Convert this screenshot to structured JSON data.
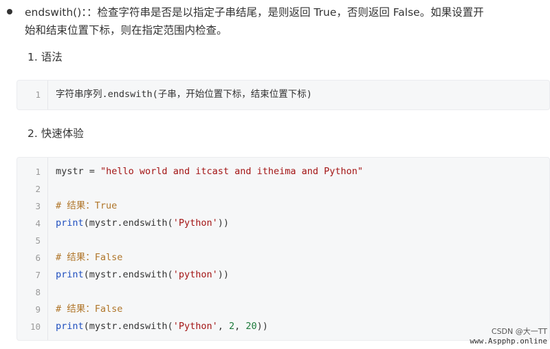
{
  "bullet": {
    "line1": "endswith()：：检查字符串是否是以指定子串结尾，是则返回 True，否则返回 False。如果设置开",
    "line2": "始和结束位置下标，则在指定范围内检查。"
  },
  "sections": [
    {
      "heading": "1. 语法"
    },
    {
      "heading": "2. 快速体验"
    }
  ],
  "syntax_block": {
    "lines": [
      {
        "num": "1",
        "code": "字符串序列.endswith(子串，开始位置下标，结束位置下标)"
      }
    ]
  },
  "demo_block": {
    "lines": [
      {
        "num": "1",
        "parts": {
          "a": "mystr = ",
          "s": "\"hello world and itcast and itheima and Python\""
        }
      },
      {
        "num": "2"
      },
      {
        "num": "3",
        "parts": {
          "c": "# 结果：True"
        }
      },
      {
        "num": "4",
        "parts": {
          "f": "print",
          "a": "(mystr.endswith(",
          "s": "'Python'",
          "b": "))"
        }
      },
      {
        "num": "5"
      },
      {
        "num": "6",
        "parts": {
          "c": "# 结果：False"
        }
      },
      {
        "num": "7",
        "parts": {
          "f": "print",
          "a": "(mystr.endswith(",
          "s": "'python'",
          "b": "))"
        }
      },
      {
        "num": "8"
      },
      {
        "num": "9",
        "parts": {
          "c": "# 结果：False"
        }
      },
      {
        "num": "10",
        "parts": {
          "f": "print",
          "a": "(mystr.endswith(",
          "s": "'Python'",
          "b": ", ",
          "n1": "2",
          "d": ", ",
          "n2": "20",
          "e": "))"
        }
      }
    ]
  },
  "watermark": {
    "line1": "CSDN @大一TT",
    "line2": "www.Aspphp.online"
  },
  "colors": {
    "function": "#1f4fbf",
    "string": "#a31515",
    "comment": "#b0762a",
    "number": "#1b7a3a"
  }
}
